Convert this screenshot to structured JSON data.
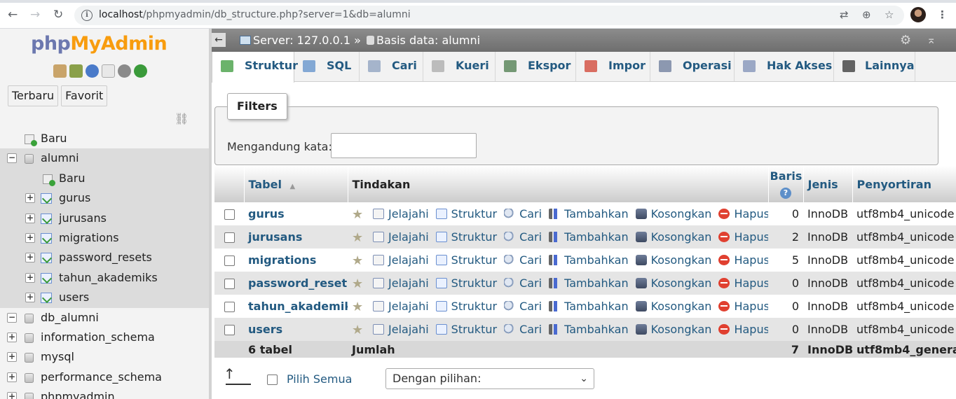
{
  "browser": {
    "url_host": "localhost",
    "url_path": "/phpmyadmin/db_structure.php?server=1&db=alumni"
  },
  "left": {
    "logo": {
      "php": "php",
      "my": "My",
      "admin": "Admin"
    },
    "recent_label": "Terbaru",
    "favorite_label": "Favorit",
    "tree": [
      {
        "label": "Baru",
        "kind": "new",
        "level": 0
      },
      {
        "label": "alumni",
        "kind": "db",
        "level": 0,
        "expanded": true,
        "selected": true
      },
      {
        "label": "Baru",
        "kind": "new",
        "level": 1,
        "selected": true
      },
      {
        "label": "gurus",
        "kind": "table",
        "level": 1,
        "selected": true
      },
      {
        "label": "jurusans",
        "kind": "table",
        "level": 1,
        "selected": true
      },
      {
        "label": "migrations",
        "kind": "table",
        "level": 1,
        "selected": true
      },
      {
        "label": "password_resets",
        "kind": "table",
        "level": 1,
        "selected": true
      },
      {
        "label": "tahun_akademiks",
        "kind": "table",
        "level": 1,
        "selected": true
      },
      {
        "label": "users",
        "kind": "table",
        "level": 1,
        "selected": true
      },
      {
        "label": "db_alumni",
        "kind": "db",
        "level": 0,
        "expanded": true
      },
      {
        "label": "information_schema",
        "kind": "db",
        "level": 0
      },
      {
        "label": "mysql",
        "kind": "db",
        "level": 0
      },
      {
        "label": "performance_schema",
        "kind": "db",
        "level": 0
      },
      {
        "label": "phpmyadmin",
        "kind": "db",
        "level": 0
      }
    ]
  },
  "serverbar": {
    "server_label": "Server: 127.0.0.1",
    "separator": "»",
    "db_label": "Basis data: alumni"
  },
  "tabs": [
    {
      "label": "Struktur",
      "active": true,
      "icon_color": "#3a9a3a"
    },
    {
      "label": "SQL",
      "active": false,
      "icon_color": "#5d8fc9"
    },
    {
      "label": "Cari",
      "active": false,
      "icon_color": "#8b9fbe"
    },
    {
      "label": "Kueri",
      "active": false,
      "icon_color": "#aaaaaa"
    },
    {
      "label": "Ekspor",
      "active": false,
      "icon_color": "#4a7a4a"
    },
    {
      "label": "Impor",
      "active": false,
      "icon_color": "#d04030"
    },
    {
      "label": "Operasi",
      "active": false,
      "icon_color": "#6a7a9a"
    },
    {
      "label": "Hak Akses",
      "active": false,
      "icon_color": "#7d8fb5"
    },
    {
      "label": "Lainnya",
      "active": false,
      "icon_color": "#333333"
    }
  ],
  "filters": {
    "legend": "Filters",
    "label": "Mengandung kata:",
    "value": ""
  },
  "table": {
    "headers": {
      "tabel": "Tabel",
      "sort_indicator": "▲",
      "tindakan": "Tindakan",
      "baris": "Baris",
      "baris_info": "?",
      "jenis": "Jenis",
      "penyortiran": "Penyortiran"
    },
    "actions": {
      "browse": "Jelajahi",
      "structure": "Struktur",
      "search": "Cari",
      "insert": "Tambahkan",
      "empty": "Kosongkan",
      "drop": "Hapus"
    },
    "rows": [
      {
        "name": "gurus",
        "rows": "0",
        "engine": "InnoDB",
        "collation": "utf8mb4_unicode"
      },
      {
        "name": "jurusans",
        "rows": "2",
        "engine": "InnoDB",
        "collation": "utf8mb4_unicode"
      },
      {
        "name": "migrations",
        "rows": "5",
        "engine": "InnoDB",
        "collation": "utf8mb4_unicode"
      },
      {
        "name": "password_resets",
        "rows": "0",
        "engine": "InnoDB",
        "collation": "utf8mb4_unicode"
      },
      {
        "name": "tahun_akademiks",
        "rows": "0",
        "engine": "InnoDB",
        "collation": "utf8mb4_unicode"
      },
      {
        "name": "users",
        "rows": "0",
        "engine": "InnoDB",
        "collation": "utf8mb4_unicode"
      }
    ],
    "footer": {
      "count": "6 tabel",
      "label": "Jumlah",
      "rows": "7",
      "engine": "InnoDB",
      "collation": "utf8mb4_genera"
    }
  },
  "bottom": {
    "select_all": "Pilih Semua",
    "with_selected": "Dengan pilihan:"
  }
}
